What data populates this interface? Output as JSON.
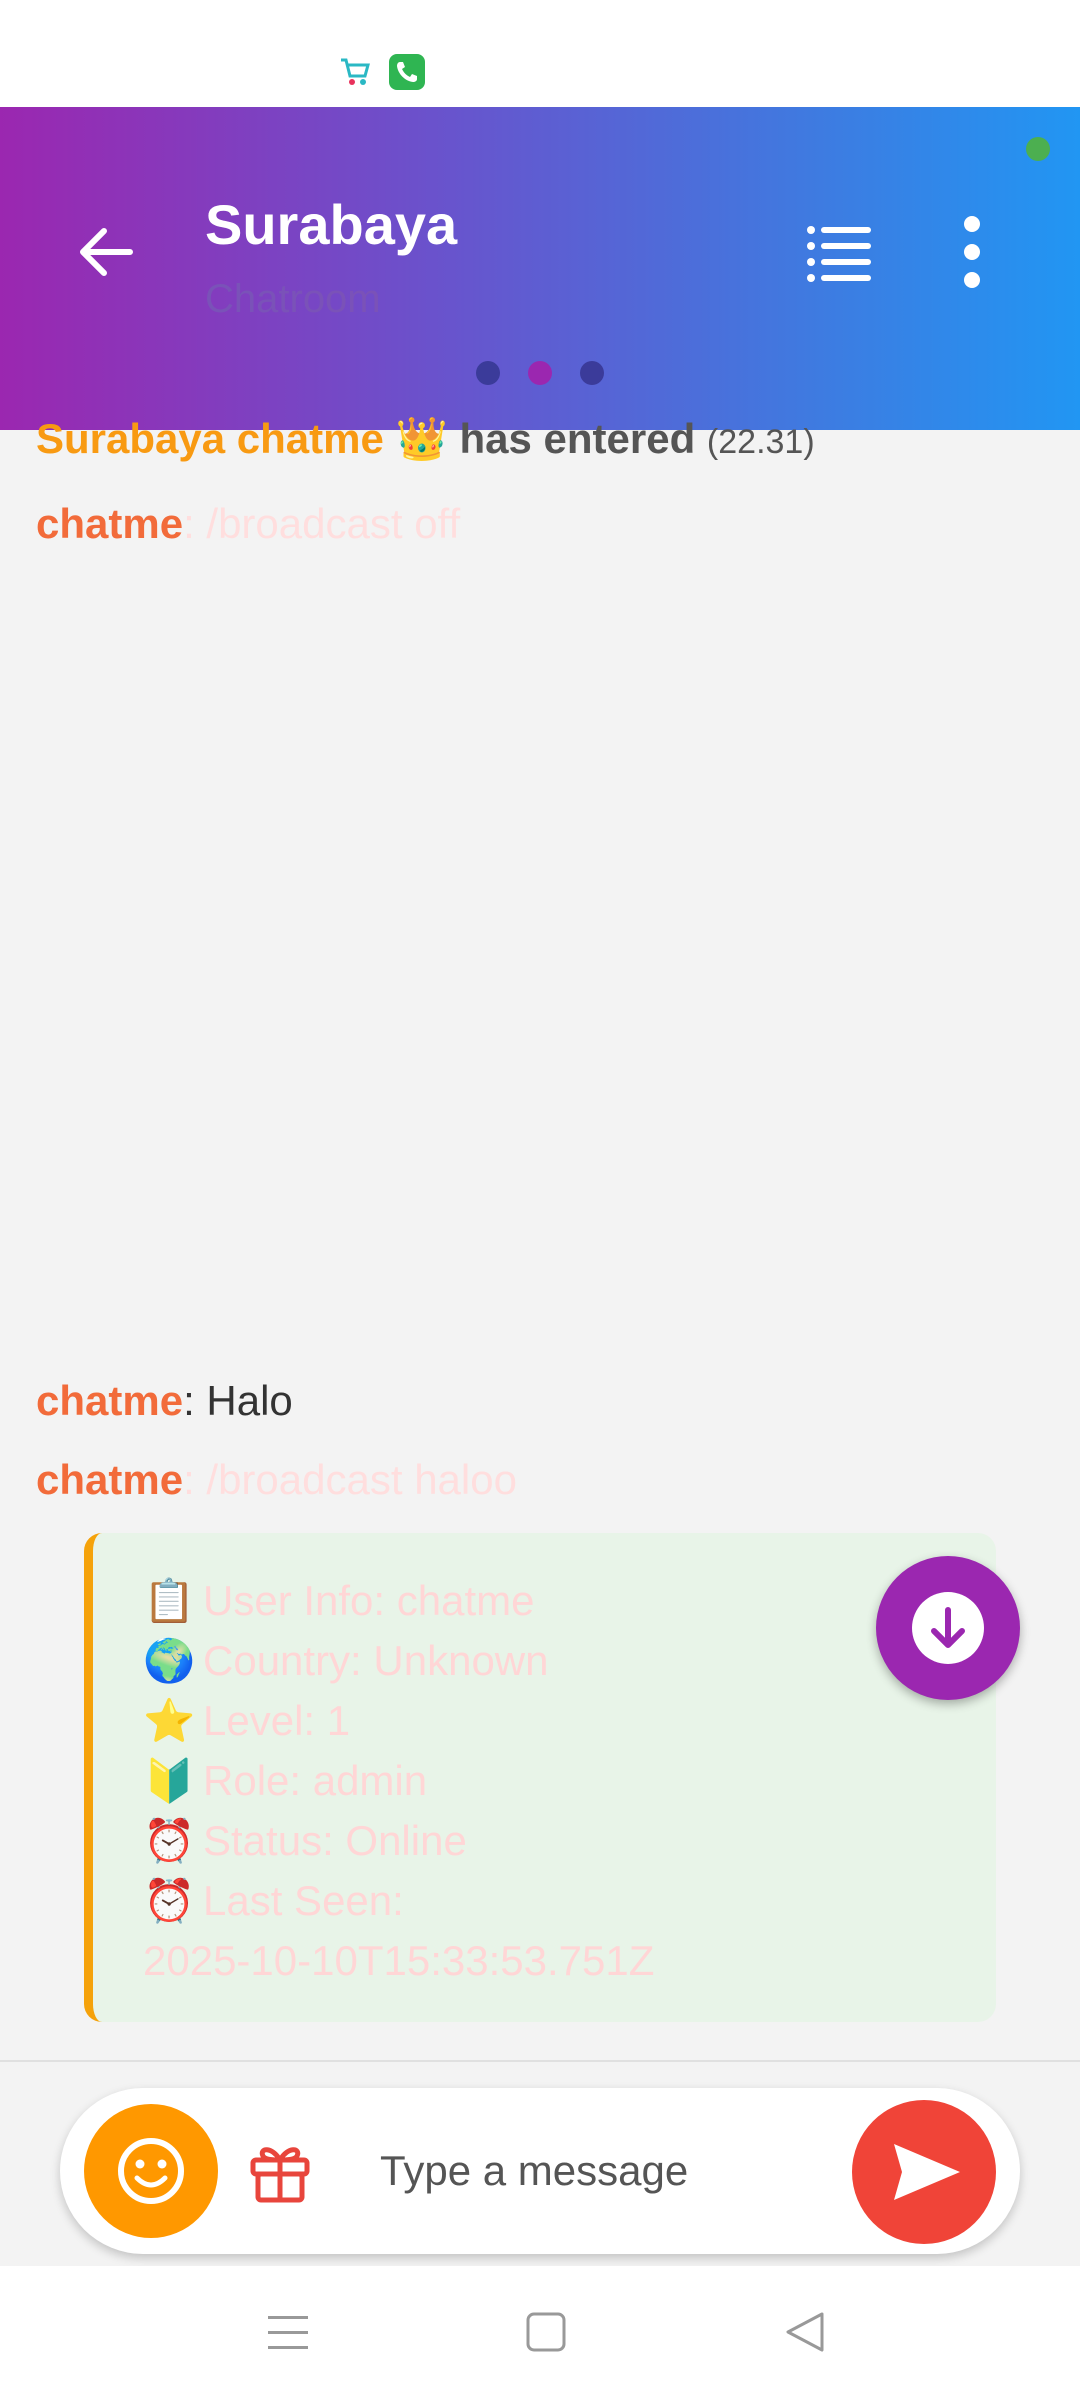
{
  "status_bar": {
    "icons": [
      "shopping-app-icon",
      "phone-call-icon"
    ]
  },
  "header": {
    "title": "Surabaya",
    "subtitle": "Chatroom",
    "pager": {
      "count": 3,
      "active_index": 1
    },
    "online_status_color": "#4caf50"
  },
  "messages": [
    {
      "user": "Surabaya chatme",
      "emoji": "👑",
      "text": "has entered",
      "time": "(22.31)"
    },
    {
      "user": "chatme",
      "separator": ":",
      "text": "/broadcast off"
    },
    {
      "user": "chatme",
      "separator": ":",
      "text": "Halo"
    },
    {
      "user": "chatme",
      "separator": ":",
      "text": "/broadcast haloo"
    }
  ],
  "info_card": {
    "lines": [
      {
        "emoji": "📋",
        "text": "User Info: chatme"
      },
      {
        "emoji": "🌍",
        "text": "Country: Unknown"
      },
      {
        "emoji": "⭐",
        "text": "Level: 1"
      },
      {
        "emoji": "🔰",
        "text": "Role: admin"
      },
      {
        "emoji": "⏰",
        "text": "Status: Online"
      },
      {
        "emoji": "⏰",
        "text": "Last Seen:"
      }
    ],
    "last_seen_value": "2025-10-10T15:33:53.751Z"
  },
  "input": {
    "placeholder": "Type a message"
  },
  "colors": {
    "header_gradient_start": "#9b27b0",
    "header_gradient_end": "#2196f3",
    "username": "#f26b3a",
    "emoji_button": "#ff9800",
    "send_button": "#f04438",
    "fab": "#9b27b0",
    "card_border": "#f5a20a"
  }
}
